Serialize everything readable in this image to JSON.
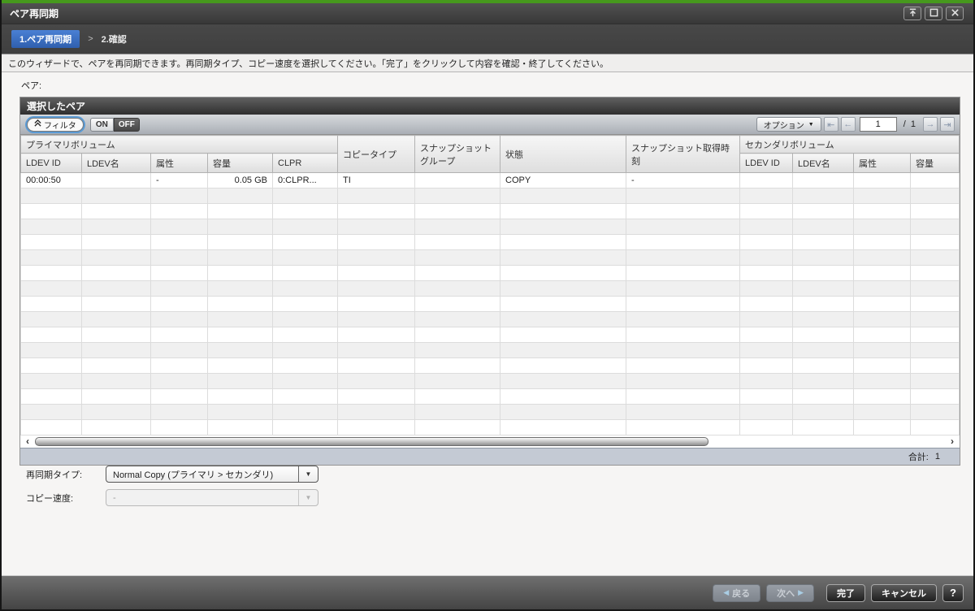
{
  "window": {
    "title": "ペア再同期"
  },
  "breadcrumb": {
    "step1": "1.ペア再同期",
    "separator": ">",
    "step2": "2.確認"
  },
  "info": {
    "message": "このウィザードで、ペアを再同期できます。再同期タイプ、コピー速度を選択してください。「完了」をクリックして内容を確認・終了してください。"
  },
  "pair": {
    "label": "ペア:"
  },
  "icons": {
    "dropdown_arrow": "▼",
    "first_page": "⇤",
    "prev_page": "←",
    "next_page": "→",
    "last_page": "⇥",
    "scroll_left": "‹",
    "scroll_right": "›",
    "back_arrow": "◀",
    "next_arrow": "▶"
  },
  "table": {
    "title": "選択したペア",
    "toolbar": {
      "filter_label": "フィルタ",
      "on_label": "ON",
      "off_label": "OFF",
      "options_label": "オプション"
    },
    "pager": {
      "current": "1",
      "separator": "/",
      "total": "1"
    },
    "columns": {
      "primary_group": "プライマリボリューム",
      "primary_sub": [
        "LDEV ID",
        "LDEV名",
        "属性",
        "容量",
        "CLPR"
      ],
      "copy_type": "コピータイプ",
      "snapshot_group": "スナップショットグループ",
      "status": "状態",
      "snapshot_time": "スナップショット取得時刻",
      "secondary_group": "セカンダリボリューム",
      "secondary_sub": [
        "LDEV ID",
        "LDEV名",
        "属性",
        "容量"
      ]
    },
    "row": [
      "00:00:50",
      "",
      "-",
      "0.05 GB",
      "0:CLPR...",
      "TI",
      "",
      "COPY",
      "-",
      "",
      "",
      "",
      ""
    ],
    "total_label": "合計:",
    "total_value": "1"
  },
  "form": {
    "resync_type_label": "再同期タイプ:",
    "resync_type_value": "Normal Copy (プライマリ > セカンダリ)",
    "copy_pace_label": "コピー速度:",
    "copy_pace_value": "-"
  },
  "footer": {
    "back": "戻る",
    "next": "次へ",
    "finish": "完了",
    "cancel": "キャンセル",
    "help": "?"
  }
}
